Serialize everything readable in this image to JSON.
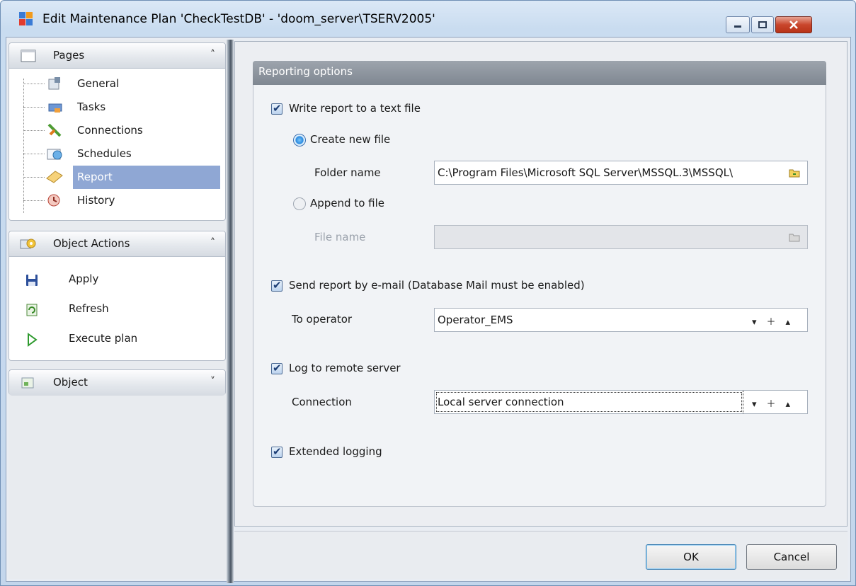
{
  "window": {
    "title": "Edit Maintenance Plan 'CheckTestDB' - 'doom_server\\TSERV2005'",
    "icons": {
      "app": "db-maintenance-icon",
      "minimize": "minimize-icon",
      "maximize": "maximize-icon",
      "close": "close-icon"
    }
  },
  "sidebar": {
    "pages": {
      "title": "Pages",
      "items": [
        {
          "label": "General",
          "icon": "general-icon",
          "selected": false
        },
        {
          "label": "Tasks",
          "icon": "tasks-icon",
          "selected": false
        },
        {
          "label": "Connections",
          "icon": "connections-icon",
          "selected": false
        },
        {
          "label": "Schedules",
          "icon": "schedules-icon",
          "selected": false
        },
        {
          "label": "Report",
          "icon": "report-icon",
          "selected": true
        },
        {
          "label": "History",
          "icon": "history-icon",
          "selected": false
        }
      ]
    },
    "object_actions": {
      "title": "Object Actions",
      "items": [
        {
          "label": "Apply",
          "icon": "save-icon"
        },
        {
          "label": "Refresh",
          "icon": "refresh-icon"
        },
        {
          "label": "Execute plan",
          "icon": "play-icon"
        }
      ]
    },
    "object": {
      "title": "Object"
    }
  },
  "reporting": {
    "header": "Reporting options",
    "write_report": {
      "label": "Write report to a text file",
      "checked": true
    },
    "create_new": {
      "label": "Create new file",
      "checked": true
    },
    "folder_label": "Folder name",
    "folder_value": "C:\\Program Files\\Microsoft SQL Server\\MSSQL.3\\MSSQL\\",
    "append": {
      "label": "Append to file",
      "checked": false
    },
    "file_label": "File name",
    "file_value": "",
    "send_email": {
      "label": "Send report by e-mail (Database Mail must be enabled)",
      "checked": true
    },
    "operator_label": "To operator",
    "operator_value": "Operator_EMS",
    "log_remote": {
      "label": "Log to remote server",
      "checked": true
    },
    "connection_label": "Connection",
    "connection_value": "Local server connection",
    "extended": {
      "label": "Extended logging",
      "checked": true
    }
  },
  "buttons": {
    "ok": "OK",
    "cancel": "Cancel"
  },
  "colors": {
    "selection": "#8fa7d4",
    "panel_header": "#8a919b",
    "accent": "#3c7fb1"
  }
}
